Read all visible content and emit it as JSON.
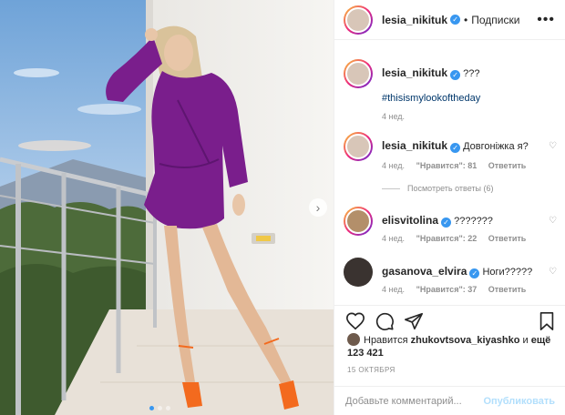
{
  "header": {
    "username": "lesia_nikituk",
    "separator": "•",
    "follow_label": "Подписки",
    "more_icon": "more-horizontal-icon"
  },
  "caption": {
    "username": "lesia_nikituk",
    "text": "???",
    "hashtag": "#thisismylookoftheday",
    "time": "4 нед."
  },
  "comments": [
    {
      "username": "lesia_nikituk",
      "text": "Довгоніжка я?",
      "time": "4 нед.",
      "likes": "\"Нравится\": 81",
      "reply": "Ответить"
    },
    {
      "username": "elisvitolina",
      "text": "???????",
      "time": "4 нед.",
      "likes": "\"Нравится\": 22",
      "reply": "Ответить"
    },
    {
      "username": "gasanova_elvira",
      "text": "Ноги?????",
      "time": "4 нед.",
      "likes": "\"Нравится\": 37",
      "reply": "Ответить"
    }
  ],
  "view_replies": "Посмотреть ответы (6)",
  "likes_line": {
    "prefix": "Нравится",
    "username": "zhukovtsova_kiyashko",
    "suffix": "и",
    "others": "ещё 123 421"
  },
  "date": "15 ОКТЯБРЯ",
  "comment_input": {
    "placeholder": "Добавьте комментарий...",
    "value": ""
  },
  "publish_label": "Опубликовать",
  "icons": [
    "heart-icon",
    "comment-icon",
    "share-icon",
    "bookmark-icon",
    "verified-icon",
    "chevron-right-icon"
  ],
  "colors": {
    "accent": "#3897f0",
    "hashtag": "#00376b",
    "muted": "#8e8e8e",
    "dress": "#7a1e8c",
    "shoes": "#f36a1e"
  }
}
